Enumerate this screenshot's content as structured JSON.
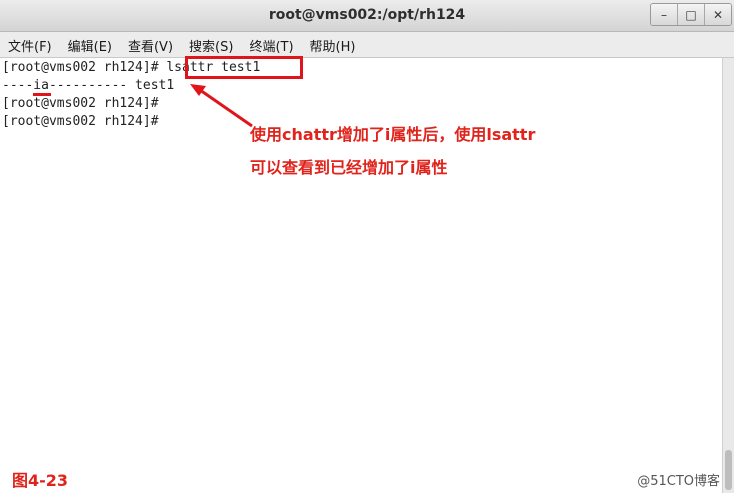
{
  "window": {
    "title": "root@vms002:/opt/rh124",
    "buttons": {
      "minimize": "–",
      "maximize": "□",
      "close": "✕"
    }
  },
  "menu": [
    "文件(F)",
    "编辑(E)",
    "查看(V)",
    "搜索(S)",
    "终端(T)",
    "帮助(H)"
  ],
  "terminal": {
    "lines": [
      "[root@vms002 rh124]# lsattr test1",
      "----ia---------- test1",
      "[root@vms002 rh124]#",
      "[root@vms002 rh124]#"
    ]
  },
  "annotation": {
    "line1": "使用chattr增加了i属性后，使用lsattr",
    "line2": "可以查看到已经增加了i属性",
    "color": "#e0241c"
  },
  "figure_label": "图4-23",
  "watermark": "@51CTO博客"
}
